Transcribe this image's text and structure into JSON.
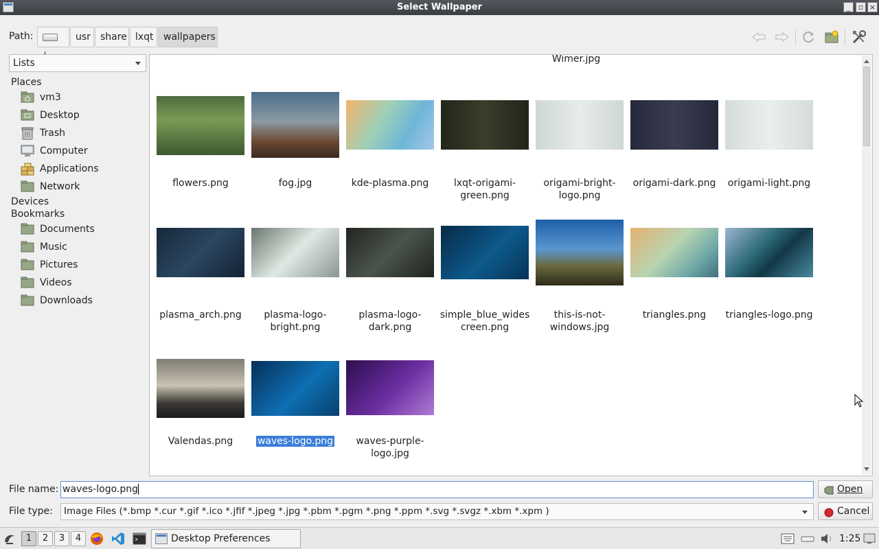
{
  "window": {
    "title": "Select Wallpaper"
  },
  "path": {
    "label": "Path:",
    "crumbs": [
      "/",
      "usr",
      "share",
      "lxqt",
      "wallpapers"
    ]
  },
  "sidebar": {
    "view_mode": "Lists",
    "places_header": "Places",
    "places": [
      "vm3",
      "Desktop",
      "Trash",
      "Computer",
      "Applications",
      "Network"
    ],
    "devices_header": "Devices",
    "bookmarks_header": "Bookmarks",
    "bookmarks": [
      "Documents",
      "Music",
      "Pictures",
      "Videos",
      "Downloads"
    ]
  },
  "files": {
    "partial_top": "Wimer.jpg",
    "items": [
      "flowers.png",
      "fog.jpg",
      "kde-plasma.png",
      "lxqt-origami-green.png",
      "origami-bright-logo.png",
      "origami-dark.png",
      "origami-light.png",
      "plasma_arch.png",
      "plasma-logo-bright.png",
      "plasma-logo-dark.png",
      "simple_blue_widescreen.png",
      "this-is-not-windows.jpg",
      "triangles.png",
      "triangles-logo.png",
      "Valendas.png",
      "waves-logo.png",
      "waves-purple-logo.jpg"
    ],
    "labels": [
      [
        "flowers.png"
      ],
      [
        "fog.jpg"
      ],
      [
        "kde-plasma.png"
      ],
      [
        "lxqt-origami-",
        "green.png"
      ],
      [
        "origami-bright-",
        "logo.png"
      ],
      [
        "origami-dark.png"
      ],
      [
        "origami-light.png"
      ],
      [
        "plasma_arch.png"
      ],
      [
        "plasma-logo-",
        "bright.png"
      ],
      [
        "plasma-logo-",
        "dark.png"
      ],
      [
        "simple_blue_wides",
        "creen.png"
      ],
      [
        "this-is-not-",
        "windows.jpg"
      ],
      [
        "triangles.png"
      ],
      [
        "triangles-logo.png"
      ],
      [
        "Valendas.png"
      ],
      [
        "waves-logo.png"
      ],
      [
        "waves-purple-",
        "logo.jpg"
      ]
    ],
    "selected": "waves-logo.png"
  },
  "bottom": {
    "filename_label": "File name:",
    "filename_value": "waves-logo.png",
    "filetype_label": "File type:",
    "filetype_value": "Image Files (*.bmp *.cur *.gif *.ico *.jfif *.jpeg *.jpg *.pbm *.pgm *.png *.ppm *.svg *.svgz *.xbm *.xpm )",
    "open_label": "Open",
    "cancel_label": "Cancel"
  },
  "taskbar": {
    "desktops": [
      "1",
      "2",
      "3",
      "4"
    ],
    "active_desktop": "1",
    "task_label": "Desktop Preferences",
    "clock": "1:25"
  },
  "colors": {
    "selection": "#3b7ed9",
    "titlebar": "#44474c"
  }
}
